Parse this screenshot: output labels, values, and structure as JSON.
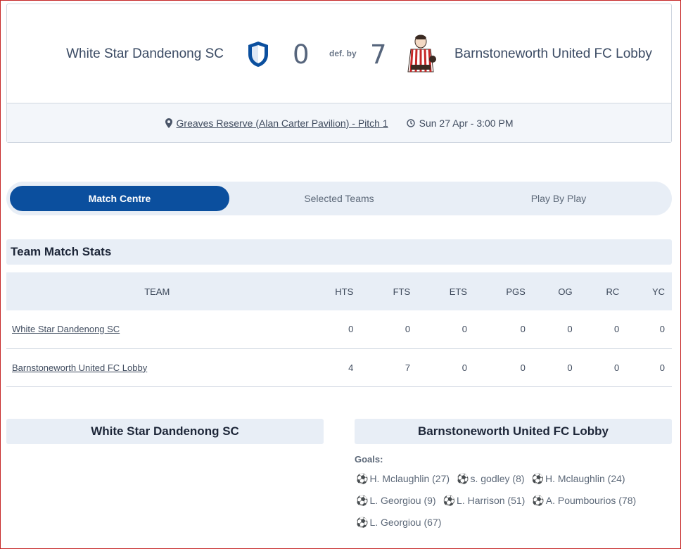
{
  "match": {
    "home_team": "White Star Dandenong SC",
    "away_team": "Barnstoneworth United FC Lobby",
    "home_score": "0",
    "away_score": "7",
    "result_label": "def. by",
    "venue": "Greaves Reserve (Alan Carter Pavilion) - Pitch 1",
    "datetime": "Sun 27 Apr - 3:00 PM",
    "colors": {
      "home_shield": "#0b4f9e",
      "away_stripes": "#c62828"
    }
  },
  "tabs": [
    {
      "label": "Match Centre",
      "active": true
    },
    {
      "label": "Selected Teams",
      "active": false
    },
    {
      "label": "Play By Play",
      "active": false
    }
  ],
  "stats": {
    "title": "Team Match Stats",
    "headers": [
      "TEAM",
      "HTS",
      "FTS",
      "ETS",
      "PGS",
      "OG",
      "RC",
      "YC"
    ],
    "rows": [
      {
        "team": "White Star Dandenong SC",
        "values": [
          "0",
          "0",
          "0",
          "0",
          "0",
          "0",
          "0"
        ]
      },
      {
        "team": "Barnstoneworth United FC Lobby",
        "values": [
          "4",
          "7",
          "0",
          "0",
          "0",
          "0",
          "0"
        ]
      }
    ]
  },
  "panels": {
    "home_title": "White Star Dandenong SC",
    "away_title": "Barnstoneworth United FC Lobby",
    "goals_label": "Goals:",
    "away_goals": [
      "H. Mclaughlin (27)",
      "s. godley (8)",
      "H. Mclaughlin (24)",
      "L. Georgiou (9)",
      "L. Harrison (51)",
      "A. Poumbourios (78)",
      "L. Georgiou (67)"
    ]
  },
  "icons": {
    "location": "map-pin-icon",
    "clock": "clock-icon",
    "ball": "soccer-ball-icon"
  }
}
